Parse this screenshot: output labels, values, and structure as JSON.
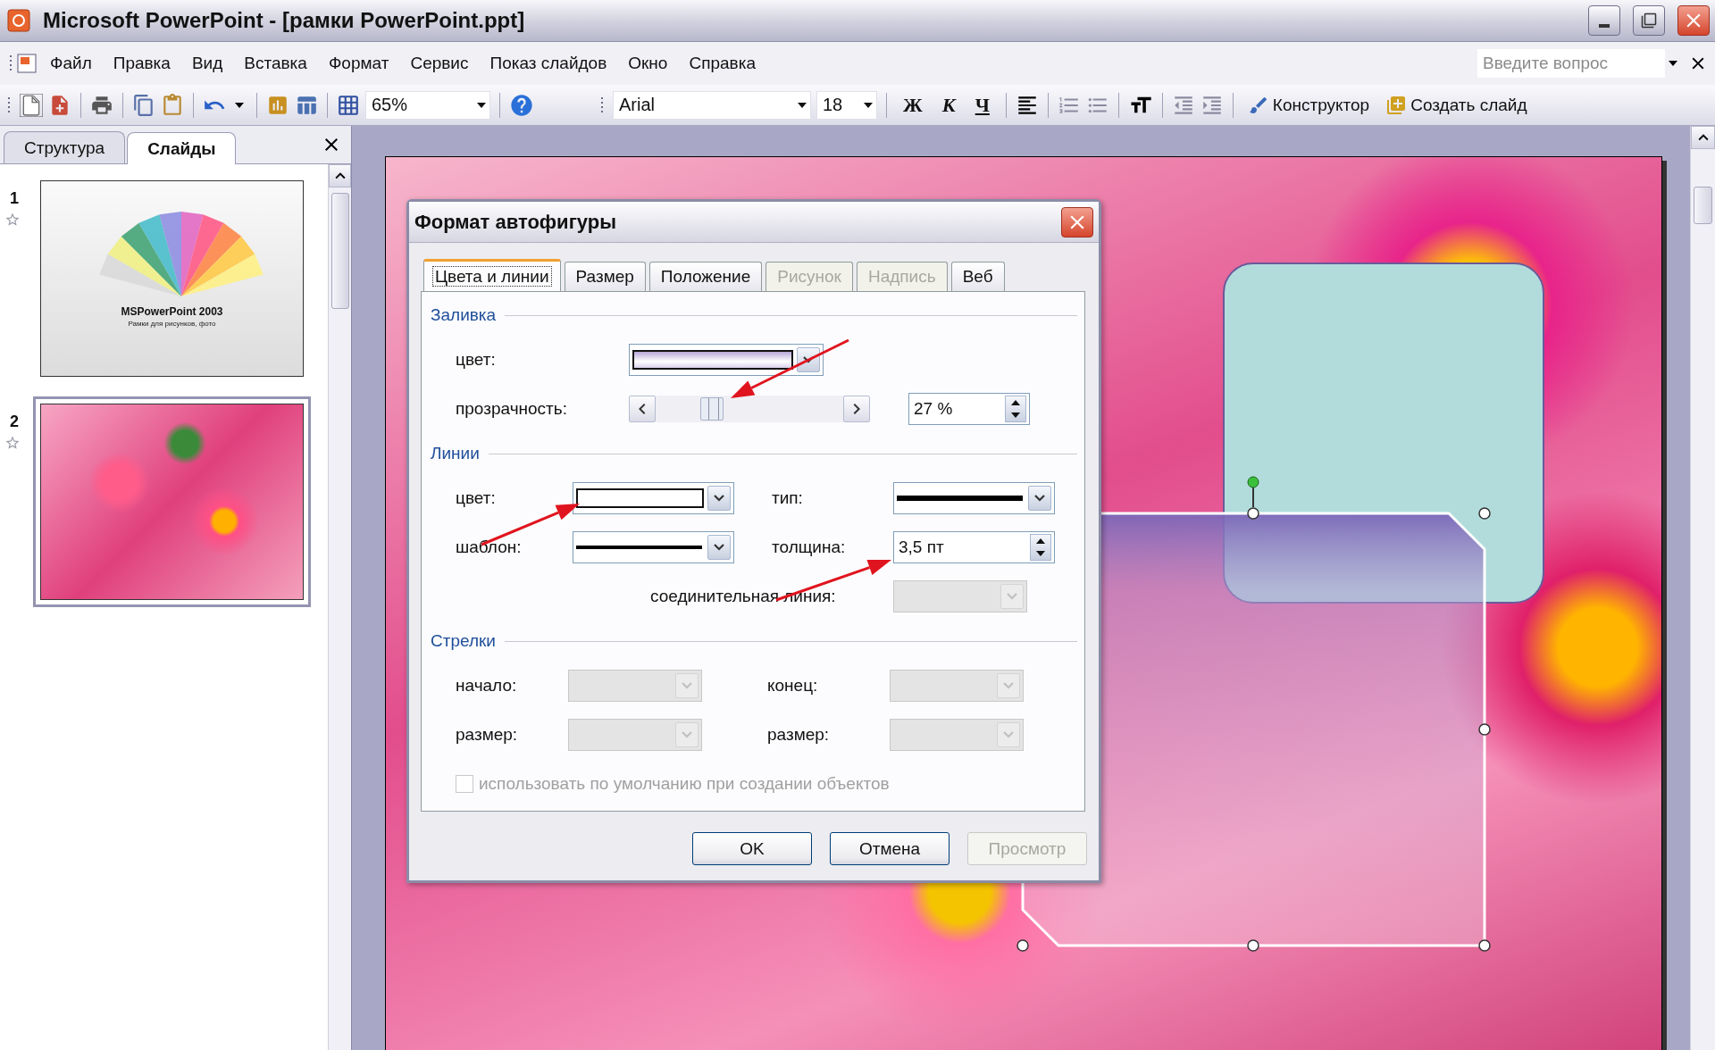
{
  "window": {
    "title": "Microsoft PowerPoint - [рамки PowerPoint.ppt]"
  },
  "menu": [
    "Файл",
    "Правка",
    "Вид",
    "Вставка",
    "Формат",
    "Сервис",
    "Показ слайдов",
    "Окно",
    "Справка"
  ],
  "help_box": {
    "placeholder": "Введите вопрос"
  },
  "toolbar": {
    "zoom": "65%",
    "font": "Arial",
    "font_size": "18",
    "format_buttons": [
      "Ж",
      "К",
      "Ч"
    ],
    "design_button": "Конструктор",
    "new_slide_button": "Создать слайд"
  },
  "pane": {
    "tabs": [
      {
        "label": "Структура",
        "selected": false
      },
      {
        "label": "Слайды",
        "selected": true
      }
    ],
    "slides": [
      {
        "number": "1",
        "selected": false,
        "kind": "title",
        "title": "MSPowerPoint 2003",
        "subtitle": "Рамки для рисунков, фото"
      },
      {
        "number": "2",
        "selected": true,
        "kind": "photo"
      }
    ]
  },
  "dialog": {
    "title": "Формат автофигуры",
    "tabs": [
      {
        "label": "Цвета и линии",
        "selected": true,
        "disabled": false
      },
      {
        "label": "Размер",
        "selected": false,
        "disabled": false
      },
      {
        "label": "Положение",
        "selected": false,
        "disabled": false
      },
      {
        "label": "Рисунок",
        "selected": false,
        "disabled": true
      },
      {
        "label": "Надпись",
        "selected": false,
        "disabled": true
      },
      {
        "label": "Веб",
        "selected": false,
        "disabled": false
      }
    ],
    "fill": {
      "heading": "Заливка",
      "color_label": "цвет:",
      "transparency_label": "прозрачность:",
      "transparency": {
        "level": 0.27,
        "value": "27 %"
      }
    },
    "lines": {
      "heading": "Линии",
      "color_label": "цвет:",
      "type_label": "тип:",
      "dash_label": "шаблон:",
      "weight_label": "толщина:",
      "weight": "3,5 пт",
      "connector_label": "соединительная линия:",
      "connector_disabled": true
    },
    "arrows": {
      "heading": "Стрелки",
      "begin_label": "начало:",
      "end_label": "конец:",
      "begin_size_label": "размер:",
      "end_size_label": "размер:",
      "disabled": true
    },
    "default_checkbox": {
      "label": "использовать по умолчанию при создании объектов",
      "checked": false,
      "disabled": true
    },
    "buttons": [
      {
        "label": "OK",
        "disabled": false
      },
      {
        "label": "Отмена",
        "disabled": false
      },
      {
        "label": "Просмотр",
        "disabled": true
      }
    ]
  }
}
